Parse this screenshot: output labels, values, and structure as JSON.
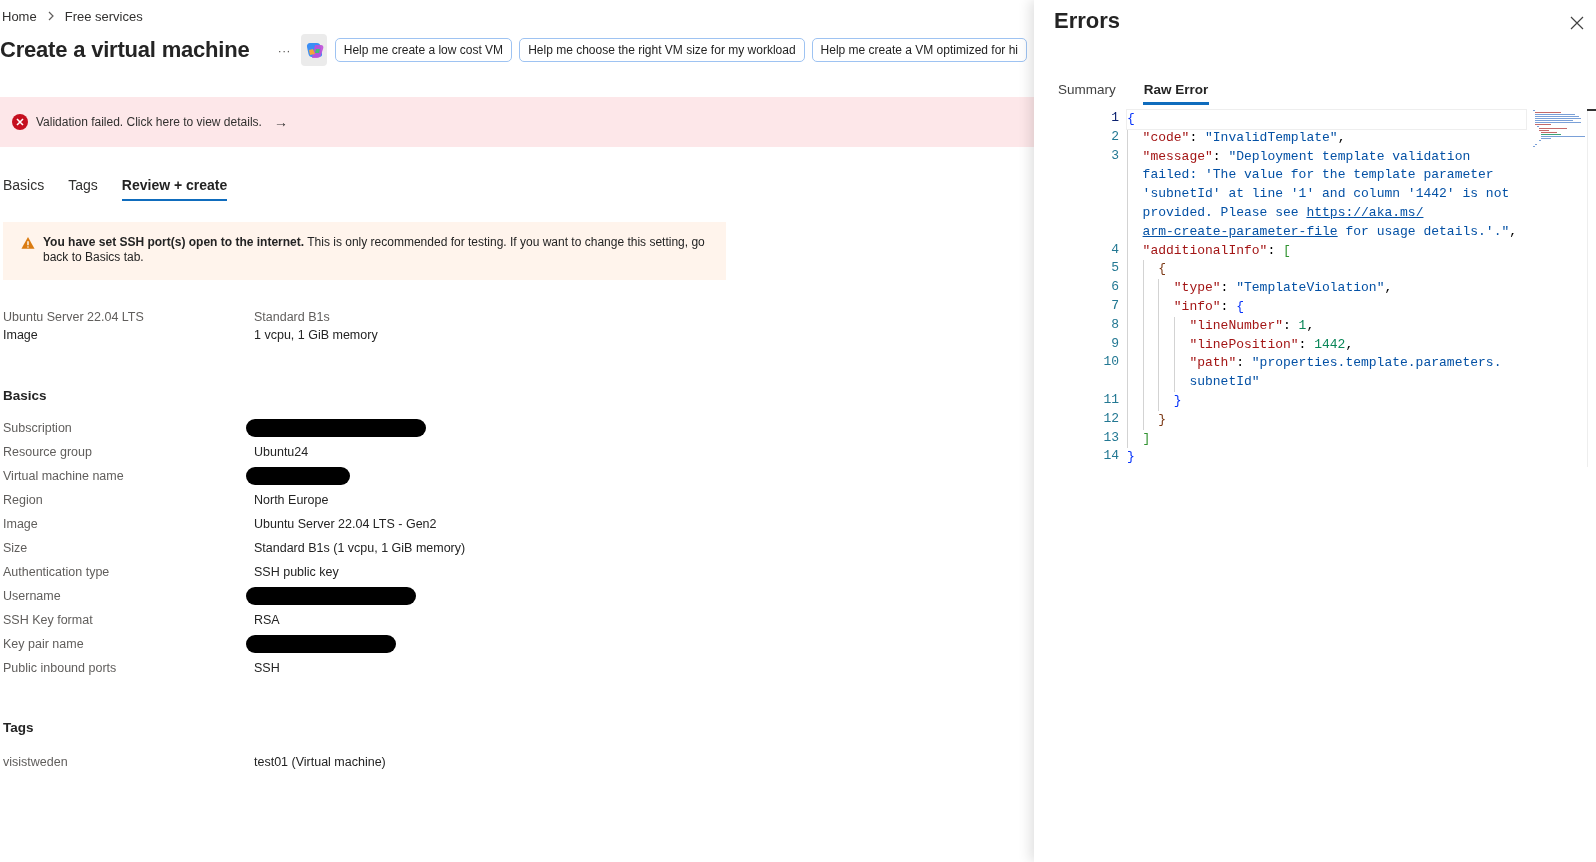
{
  "breadcrumb": [
    "Home",
    "Free services"
  ],
  "title": "Create a virtual machine",
  "more": "···",
  "suggestions": [
    "Help me create a low cost VM",
    "Help me choose the right VM size for my workload",
    "Help me create a VM optimized for hi"
  ],
  "error_banner": {
    "text": "Validation failed. Click here to view details.",
    "arrow": "→"
  },
  "tabs": [
    {
      "label": "Basics",
      "selected": false
    },
    {
      "label": "Tags",
      "selected": false
    },
    {
      "label": "Review + create",
      "selected": true
    }
  ],
  "warning": "**You have set SSH port(s) open to the internet.** This is only recommended for testing. If you want to change this setting, go back to Basics tab.",
  "overview": [
    {
      "value": "Ubuntu Server 22.04 LTS",
      "label": "Image"
    },
    {
      "value": "Standard B1s",
      "label": "1 vcpu, 1 GiB memory"
    }
  ],
  "sections": [
    {
      "heading": "Basics",
      "rows": [
        {
          "label": "Subscription",
          "redacted": true
        },
        {
          "label": "Resource group",
          "value": "Ubuntu24",
          "redacted": false
        },
        {
          "label": "Virtual machine name",
          "redacted": true
        },
        {
          "label": "Region",
          "value": "North Europe",
          "redacted": false
        },
        {
          "label": "Image",
          "value": "Ubuntu Server 22.04 LTS - Gen2",
          "redacted": false
        },
        {
          "label": "Size",
          "value": "Standard B1s (1 vcpu, 1 GiB memory)",
          "redacted": false
        },
        {
          "label": "Authentication type",
          "value": "SSH public key",
          "redacted": false
        },
        {
          "label": "Username",
          "redacted": true
        },
        {
          "label": "SSH Key format",
          "value": "RSA",
          "redacted": false
        },
        {
          "label": "Key pair name",
          "redacted": true
        },
        {
          "label": "Public inbound ports",
          "value": "SSH",
          "redacted": false
        }
      ]
    },
    {
      "heading": "Tags",
      "rows": [
        {
          "label": "visistweden",
          "value": "test01 (Virtual machine)",
          "redacted": false
        }
      ]
    }
  ],
  "panel": {
    "title": "Errors",
    "tabs": [
      {
        "label": "Summary",
        "selected": false
      },
      {
        "label": "Raw Error",
        "selected": true
      }
    ],
    "code": [
      {
        "number": "1",
        "tokens": [
          {
            "kind": "bracket",
            "text": "{"
          }
        ]
      },
      {
        "number": "2",
        "tokens": [
          {
            "kind": "key",
            "text": "\"code\""
          },
          {
            "kind": "punct",
            "text": ": "
          },
          {
            "kind": "string",
            "text": "\"InvalidTemplate\""
          },
          {
            "kind": "punct",
            "text": ","
          }
        ]
      },
      {
        "number": "3",
        "tokens": [
          {
            "kind": "key",
            "text": "\"message\""
          },
          {
            "kind": "punct",
            "text": ": "
          },
          {
            "kind": "string",
            "text": "\"Deployment template validation"
          }
        ]
      },
      {
        "tokens": [
          {
            "kind": "string",
            "text": "failed: 'The value for the template parameter"
          }
        ]
      },
      {
        "tokens": [
          {
            "kind": "string",
            "text": "'subnetId' at line '1' and column '1442' is not"
          }
        ]
      },
      {
        "tokens": [
          {
            "kind": "string",
            "text": "provided. Please see "
          },
          {
            "kind": "link",
            "text": "https://aka.ms/"
          }
        ]
      },
      {
        "tokens": [
          {
            "kind": "link",
            "text": "arm-create-parameter-file"
          },
          {
            "kind": "string",
            "text": " for usage details.'.\""
          },
          {
            "kind": "punct",
            "text": ","
          }
        ]
      },
      {
        "number": "4",
        "tokens": [
          {
            "kind": "key",
            "text": "\"additionalInfo\""
          },
          {
            "kind": "punct",
            "text": ": "
          },
          {
            "kind": "bracket",
            "text": "["
          }
        ]
      },
      {
        "number": "5",
        "tokens": [
          {
            "kind": "bracket",
            "text": "{"
          }
        ]
      },
      {
        "number": "6",
        "tokens": [
          {
            "kind": "key",
            "text": "\"type\""
          },
          {
            "kind": "punct",
            "text": ": "
          },
          {
            "kind": "string",
            "text": "\"TemplateViolation\""
          },
          {
            "kind": "punct",
            "text": ","
          }
        ]
      },
      {
        "number": "7",
        "tokens": [
          {
            "kind": "key",
            "text": "\"info\""
          },
          {
            "kind": "punct",
            "text": ": "
          },
          {
            "kind": "bracket",
            "text": "{"
          }
        ]
      },
      {
        "number": "8",
        "tokens": [
          {
            "kind": "key",
            "text": "\"lineNumber\""
          },
          {
            "kind": "punct",
            "text": ": "
          },
          {
            "kind": "number",
            "text": "1"
          },
          {
            "kind": "punct",
            "text": ","
          }
        ]
      },
      {
        "number": "9",
        "tokens": [
          {
            "kind": "key",
            "text": "\"linePosition\""
          },
          {
            "kind": "punct",
            "text": ": "
          },
          {
            "kind": "number",
            "text": "1442"
          },
          {
            "kind": "punct",
            "text": ","
          }
        ]
      },
      {
        "number": "10",
        "tokens": [
          {
            "kind": "key",
            "text": "\"path\""
          },
          {
            "kind": "punct",
            "text": ": "
          },
          {
            "kind": "string",
            "text": "\"properties.template.parameters."
          }
        ]
      },
      {
        "tokens": [
          {
            "kind": "string",
            "text": "subnetId\""
          }
        ]
      },
      {
        "number": "11",
        "tokens": [
          {
            "kind": "bracket",
            "text": "}"
          }
        ]
      },
      {
        "number": "12",
        "tokens": [
          {
            "kind": "bracket",
            "text": "}"
          }
        ]
      },
      {
        "number": "13",
        "tokens": [
          {
            "kind": "bracket",
            "text": "]"
          }
        ]
      },
      {
        "number": "14",
        "tokens": [
          {
            "kind": "bracket",
            "text": "}"
          }
        ]
      }
    ]
  }
}
